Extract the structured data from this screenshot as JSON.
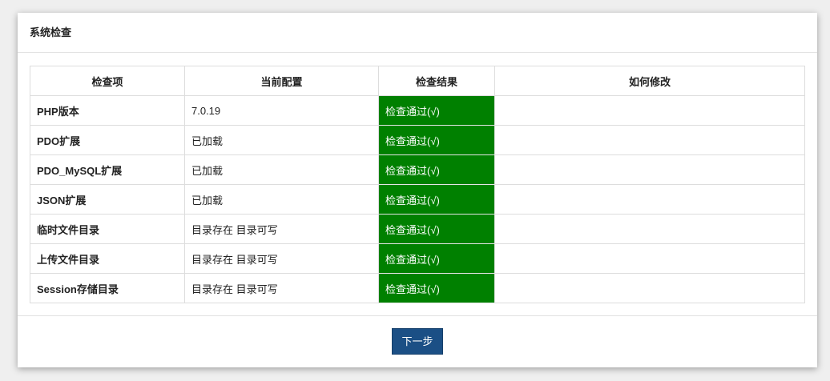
{
  "title": "系统检查",
  "headers": [
    "检查项",
    "当前配置",
    "检查结果",
    "如何修改"
  ],
  "rows": [
    {
      "item": "PHP版本",
      "config": "7.0.19",
      "result": "检查通过(√)",
      "fix": ""
    },
    {
      "item": "PDO扩展",
      "config": "已加载",
      "result": "检查通过(√)",
      "fix": ""
    },
    {
      "item": "PDO_MySQL扩展",
      "config": "已加载",
      "result": "检查通过(√)",
      "fix": ""
    },
    {
      "item": "JSON扩展",
      "config": "已加载",
      "result": "检查通过(√)",
      "fix": ""
    },
    {
      "item": "临时文件目录",
      "config": "目录存在 目录可写",
      "result": "检查通过(√)",
      "fix": ""
    },
    {
      "item": "上传文件目录",
      "config": "目录存在 目录可写",
      "result": "检查通过(√)",
      "fix": ""
    },
    {
      "item": "Session存储目录",
      "config": "目录存在 目录可写",
      "result": "检查通过(√)",
      "fix": ""
    }
  ],
  "next_label": "下一步",
  "colors": {
    "pass": "#008000",
    "button": "#1b4f85"
  }
}
